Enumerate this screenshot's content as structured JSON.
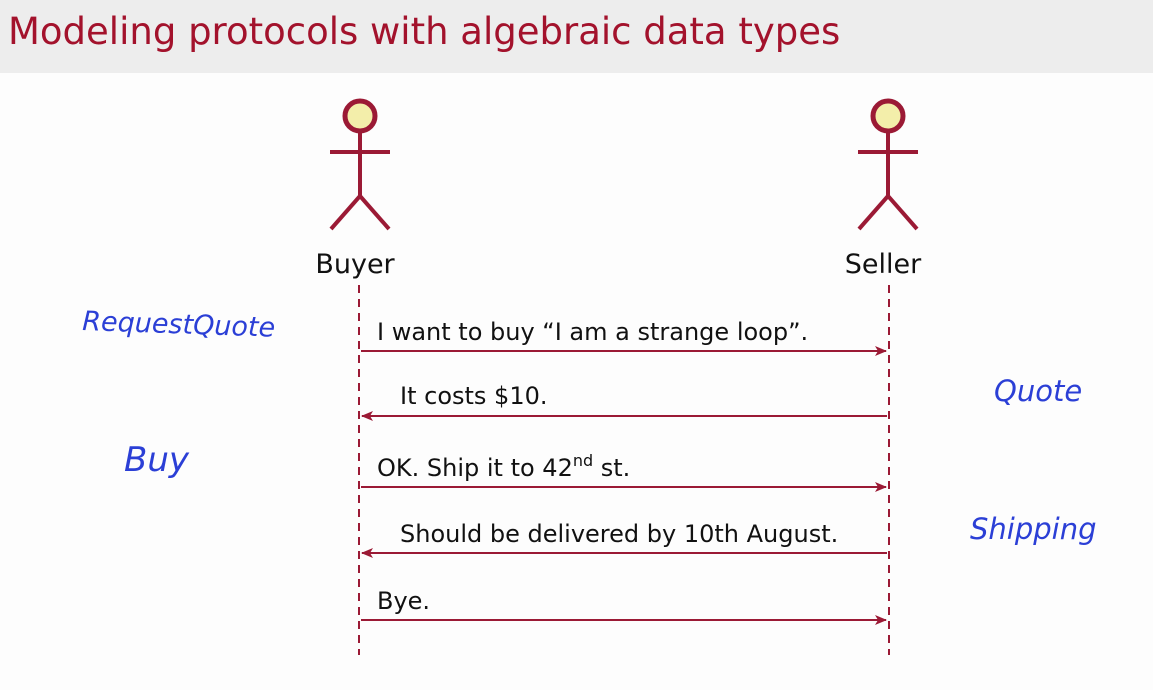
{
  "title": "Modeling protocols with algebraic data types",
  "actors": {
    "buyer": "Buyer",
    "seller": "Seller"
  },
  "messages": [
    {
      "text": "I want to buy “I am a strange loop”.",
      "direction": "buyer-to-seller"
    },
    {
      "text": "It costs $10.",
      "direction": "seller-to-buyer"
    },
    {
      "text_main": "OK. Ship it to 42",
      "text_sup": "nd",
      "text_end": " st.",
      "direction": "buyer-to-seller"
    },
    {
      "text": "Should be delivered by 10th August.",
      "direction": "seller-to-buyer"
    },
    {
      "text": "Bye.",
      "direction": "buyer-to-seller"
    }
  ],
  "annotations": {
    "request_quote": "RequestQuote",
    "quote": "Quote",
    "buy": "Buy",
    "shipping": "Shipping"
  },
  "colors": {
    "title": "#a3122c",
    "arrow": "#9b1a35",
    "actor_head_fill": "#f3eeaa",
    "handwriting": "#2b3fd6"
  }
}
